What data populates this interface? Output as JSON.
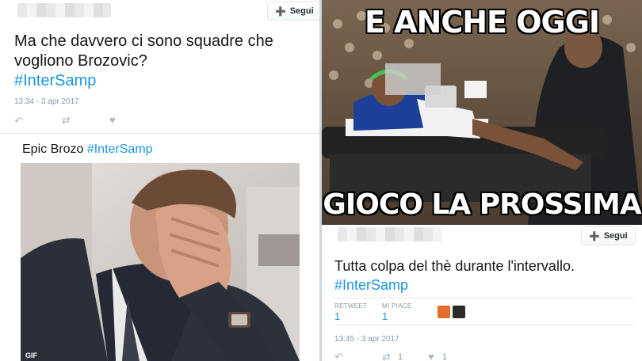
{
  "tweet1": {
    "follow_label": "Segui",
    "text_line1": "Ma che davvero ci sono squadre che",
    "text_line2": "vogliono Brozovic?",
    "hashtag": "#InterSamp",
    "timestamp": "13:34 - 3 apr 2017"
  },
  "tweet2": {
    "text_plain": "Epic Brozo",
    "hashtag": "#InterSamp",
    "gif_badge": "GIF"
  },
  "meme": {
    "caption_top": "E ANCHE OGGI",
    "caption_bottom": "GIOCO LA PROSSIMA"
  },
  "tweet3": {
    "follow_label": "Segui",
    "text_line1": "Tutta colpa del thè durante l'intervallo.",
    "hashtag": "#InterSamp",
    "retweet_label": "RETWEET",
    "retweet_count": "1",
    "likes_label": "MI PIACE",
    "likes_count": "1",
    "timestamp": "13:45 - 3 apr 2017",
    "action_retweet_count": "1",
    "action_like_count": "1"
  },
  "colors": {
    "hashtag": "#1b95e0",
    "meta": "#8899a6",
    "action": "#aab8c2"
  }
}
